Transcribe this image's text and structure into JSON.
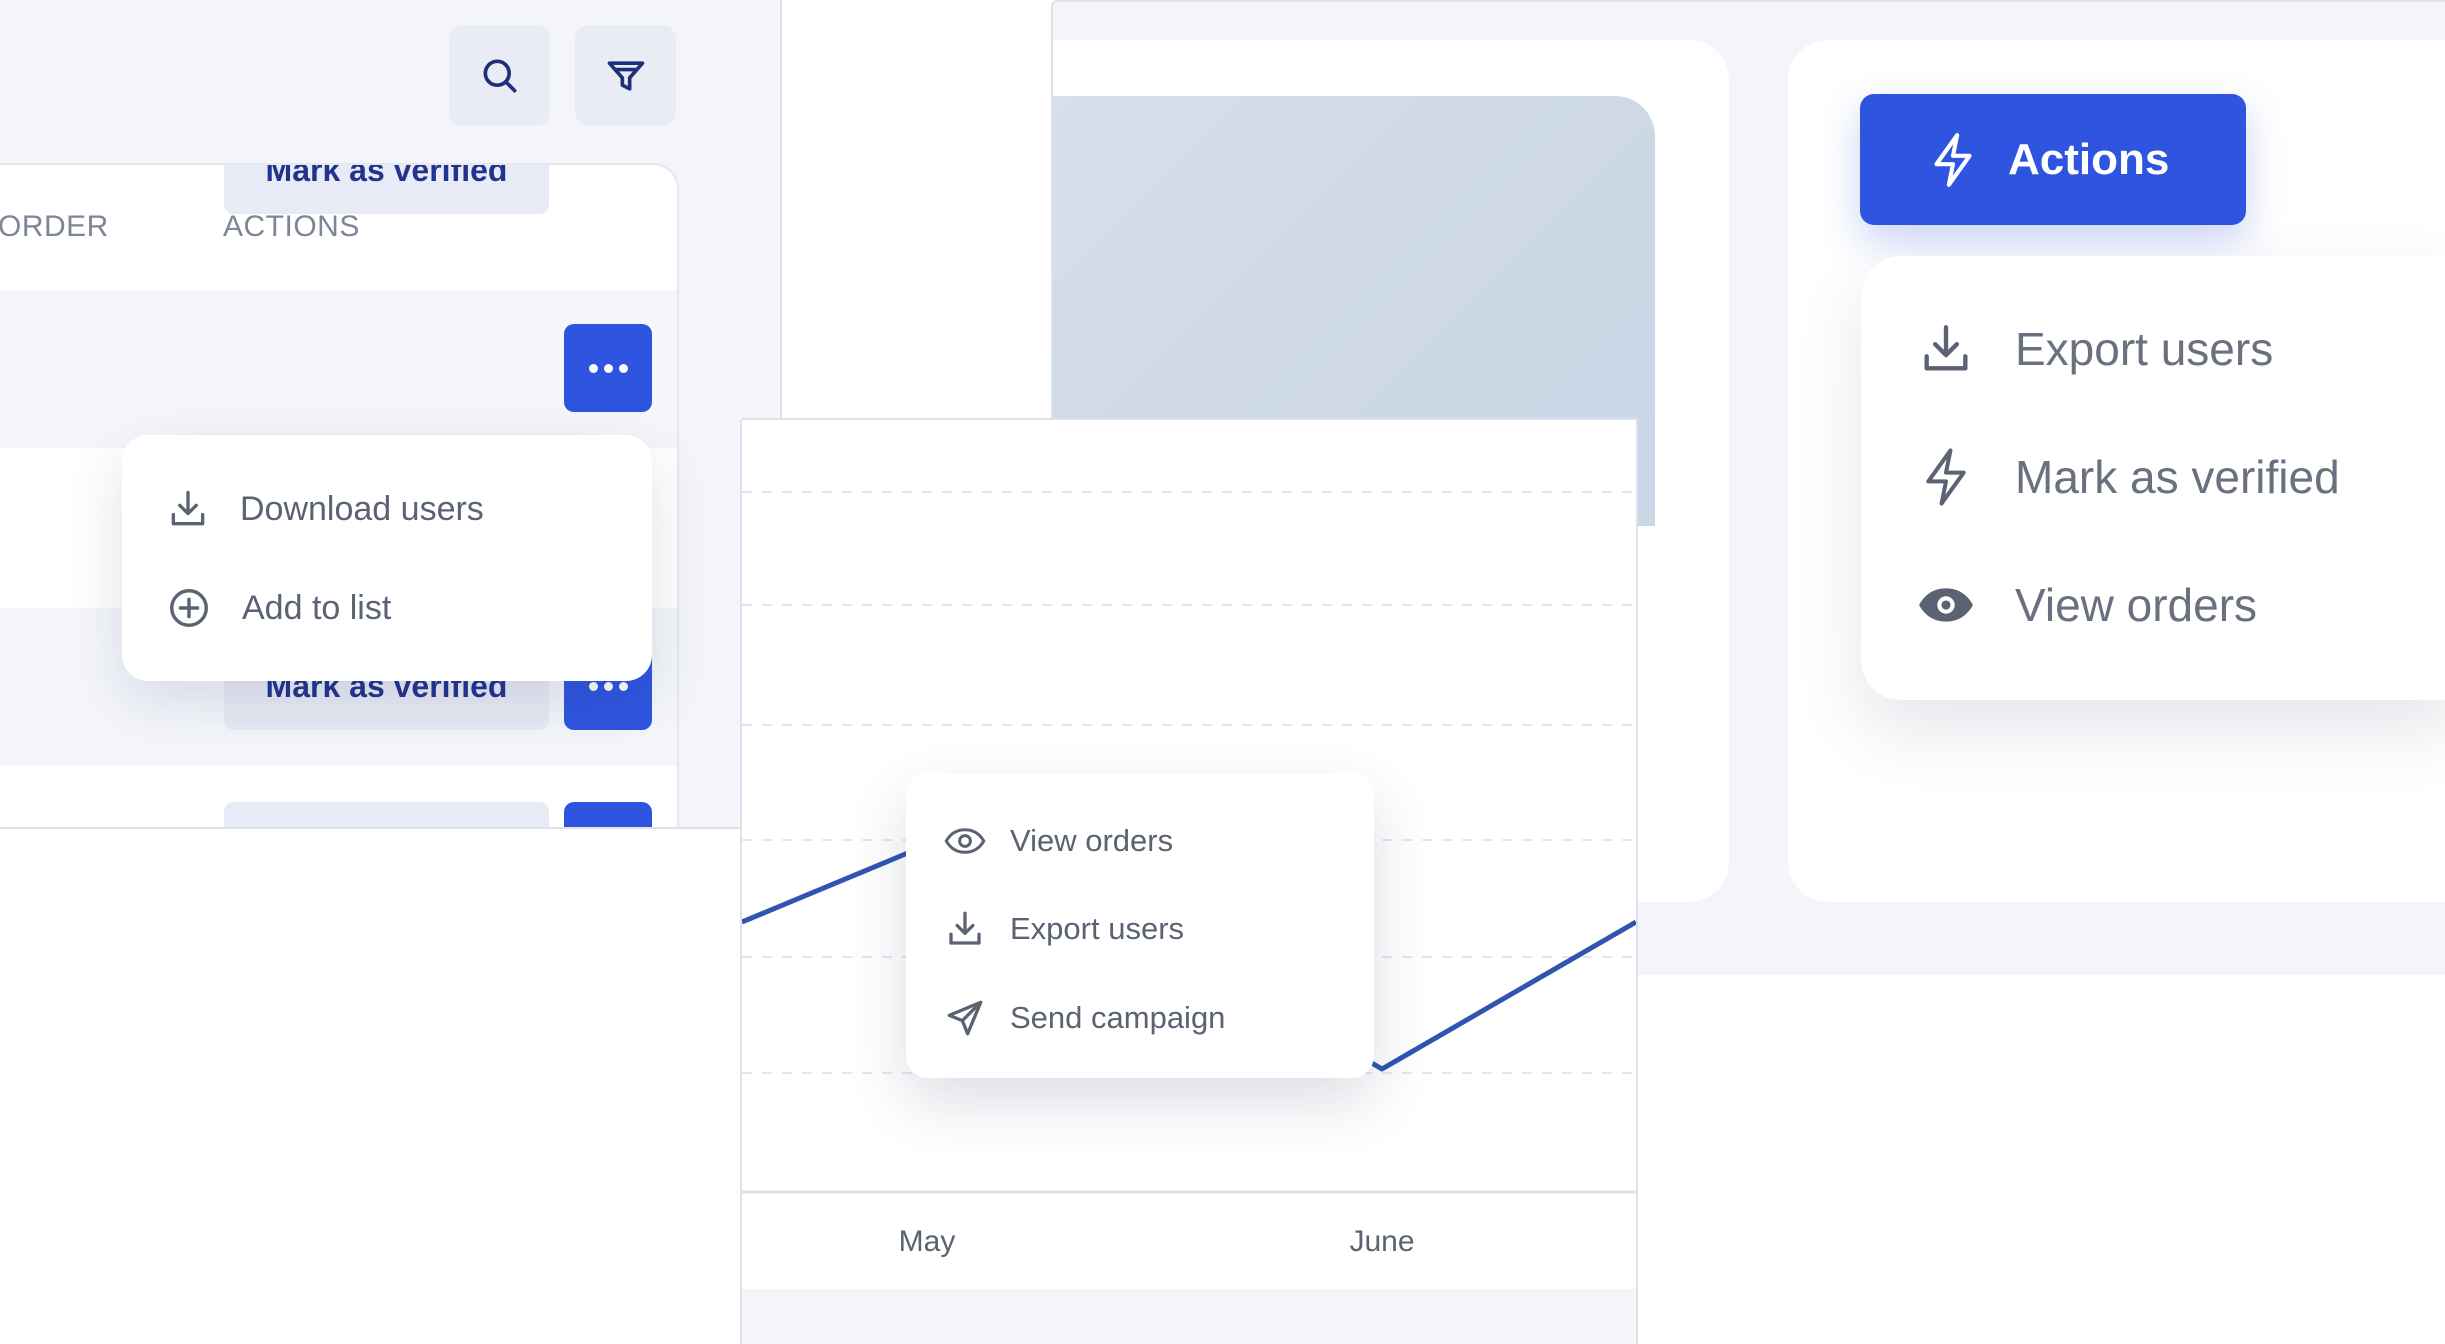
{
  "left": {
    "toolbar": {
      "search_icon": "search-icon",
      "filter_icon": "filter-icon"
    },
    "table": {
      "columns": [
        "ORDER",
        "ACTIONS"
      ],
      "rows": [
        {
          "action_label": "Mark as verified"
        },
        {
          "action_label": "Mark as verified"
        },
        {
          "action_label": ""
        }
      ]
    },
    "row_menu": {
      "items": [
        {
          "label": "Download users",
          "icon": "download-icon"
        },
        {
          "label": "Add to list",
          "icon": "plus-circle-icon"
        }
      ]
    }
  },
  "chart": {
    "menu": {
      "items": [
        {
          "label": "View orders",
          "icon": "eye-icon"
        },
        {
          "label": "Export users",
          "icon": "download-icon"
        },
        {
          "label": "Send campaign",
          "icon": "send-icon"
        }
      ]
    }
  },
  "chart_data": {
    "type": "line",
    "x": [
      "",
      "May",
      "",
      "June",
      ""
    ],
    "xlabel": "",
    "ylabel": "",
    "grid": true,
    "series": [
      {
        "values": [
          0.38,
          0.49,
          0.38,
          0.17,
          0.38
        ]
      }
    ],
    "ylim": [
      0,
      1
    ],
    "line_color": "#2f55b0"
  },
  "right": {
    "actions_button": {
      "label": "Actions",
      "icon": "lightning-icon"
    },
    "actions_menu": {
      "items": [
        {
          "label": "Export users",
          "icon": "download-icon"
        },
        {
          "label": "Mark as verified",
          "icon": "lightning-icon"
        },
        {
          "label": "View orders",
          "icon": "eye-filled-icon"
        }
      ]
    }
  },
  "colors": {
    "accent": "#2f55e0",
    "panel_bg": "#f3f5fa",
    "text_muted": "#7e8597"
  }
}
